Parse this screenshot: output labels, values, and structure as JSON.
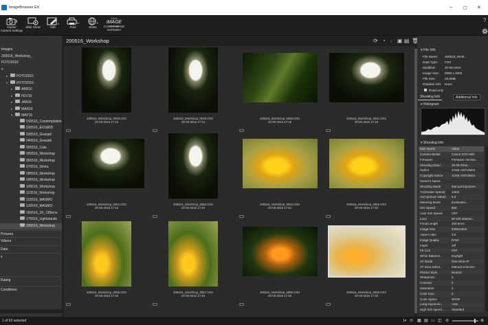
{
  "window": {
    "title": "ImageBrowser EX",
    "min": "–",
    "max": "◻",
    "close": "✕"
  },
  "toolbar": {
    "buttons": [
      {
        "label1": "Import/",
        "label2": "Camera Settings",
        "icon": "camera-icon"
      },
      {
        "label1": "Slide Show",
        "label2": "",
        "icon": "slideshow-icon"
      },
      {
        "label1": "Edit",
        "label2": "",
        "icon": "edit-icon"
      },
      {
        "label1": "Print",
        "label2": "",
        "icon": "printer-icon"
      },
      {
        "label1": "Share",
        "label2": "",
        "icon": "globe-icon"
      },
      {
        "label1": "CANON IMAGE",
        "label2": "GATEWAY",
        "icon": "canon-image-gateway-icon"
      }
    ],
    "help": "?",
    "gateway_logo_top": "Canon",
    "gateway_logo_main": "iMAGE",
    "gateway_logo_sub": "GATEWAY"
  },
  "sidebar": {
    "items": [
      {
        "label": "Images",
        "indent": 0,
        "arrow": "",
        "folder": false,
        "selected": false
      },
      {
        "label": "200516_Workshop_",
        "indent": 0,
        "arrow": "",
        "folder": false,
        "selected": false
      },
      {
        "label": "FOTO2016",
        "indent": 0,
        "arrow": "",
        "folder": false,
        "selected": false
      },
      {
        "label": "s",
        "indent": 0,
        "arrow": "",
        "folder": false,
        "selected": false
      },
      {
        "label": "FOTO2015",
        "indent": 1,
        "arrow": "▸",
        "folder": true,
        "selected": false
      },
      {
        "label": "FOTO2016",
        "indent": 1,
        "arrow": "▾",
        "folder": true,
        "selected": false
      },
      {
        "label": "ABR16",
        "indent": 2,
        "arrow": "▸",
        "folder": true,
        "selected": false
      },
      {
        "label": "FEV16",
        "indent": 2,
        "arrow": "▸",
        "folder": true,
        "selected": false
      },
      {
        "label": "JAN16",
        "indent": 2,
        "arrow": "▸",
        "folder": true,
        "selected": false
      },
      {
        "label": "MAR16",
        "indent": 2,
        "arrow": "▸",
        "folder": true,
        "selected": false
      },
      {
        "label": "MAY16",
        "indent": 2,
        "arrow": "▾",
        "folder": true,
        "selected": false
      },
      {
        "label": "010516_Contemplation",
        "indent": 3,
        "arrow": "",
        "folder": true,
        "selected": false
      },
      {
        "label": "030516_EOS80D",
        "indent": 3,
        "arrow": "",
        "folder": true,
        "selected": false
      },
      {
        "label": "030516_Granjall",
        "indent": 3,
        "arrow": "",
        "folder": true,
        "selected": false
      },
      {
        "label": "040516_Granjall",
        "indent": 3,
        "arrow": "",
        "folder": true,
        "selected": false
      },
      {
        "label": "050516_Cats",
        "indent": 3,
        "arrow": "",
        "folder": true,
        "selected": false
      },
      {
        "label": "050516_Workshop",
        "indent": 3,
        "arrow": "",
        "folder": true,
        "selected": false
      },
      {
        "label": "060516_Workshop",
        "indent": 3,
        "arrow": "",
        "folder": true,
        "selected": false
      },
      {
        "label": "070516_Sintra",
        "indent": 3,
        "arrow": "",
        "folder": true,
        "selected": false
      },
      {
        "label": "080516_Workshop",
        "indent": 3,
        "arrow": "",
        "folder": true,
        "selected": false
      },
      {
        "label": "090516_Workshop",
        "indent": 3,
        "arrow": "",
        "folder": true,
        "selected": false
      },
      {
        "label": "100516_Workshop",
        "indent": 3,
        "arrow": "",
        "folder": true,
        "selected": false
      },
      {
        "label": "110516_Workshop",
        "indent": 3,
        "arrow": "",
        "folder": true,
        "selected": false
      },
      {
        "label": "120516_MASMO",
        "indent": 3,
        "arrow": "",
        "folder": true,
        "selected": false
      },
      {
        "label": "130516_MASMO",
        "indent": 3,
        "arrow": "",
        "folder": true,
        "selected": false
      },
      {
        "label": "160516_18_135lens",
        "indent": 3,
        "arrow": "",
        "folder": true,
        "selected": false
      },
      {
        "label": "170516_Lightstands",
        "indent": 3,
        "arrow": "",
        "folder": true,
        "selected": false
      },
      {
        "label": "200516_Workshop",
        "indent": 3,
        "arrow": "",
        "folder": true,
        "selected": true
      }
    ],
    "sections": [
      "Pictures",
      "Videos",
      "",
      "Date",
      "s",
      "",
      "Rating",
      "",
      "Conditions"
    ]
  },
  "main": {
    "folder_title": "200516_Workshop",
    "search_placeholder": "",
    "thumbnails": [
      {
        "name": "200516_Workshop_0048.CR2",
        "date": "20-05-2016 17:15",
        "kind": "calla-dark",
        "orient": "portrait"
      },
      {
        "name": "200516_Workshop_0049.CR2",
        "date": "20-05-2016 17:16",
        "kind": "calla-dark",
        "orient": "portrait"
      },
      {
        "name": "200516_Workshop_0050.CR2",
        "date": "20-05-2016 17:18",
        "kind": "leaf",
        "orient": "landscape"
      },
      {
        "name": "200516_Workshop_0051.CR2",
        "date": "20-05-2016 17:18",
        "kind": "calla-dark",
        "orient": "landscape"
      },
      {
        "name": "200516_Workshop_0052.CR2",
        "date": "20-05-2016 17:19",
        "kind": "calla-dark",
        "orient": "landscape"
      },
      {
        "name": "200516_Workshop_0053.CR2",
        "date": "20-05-2016 17:20",
        "kind": "calla-dark",
        "orient": "portrait"
      },
      {
        "name": "200516_Workshop_0054.CR2",
        "date": "20-05-2016 17:34",
        "kind": "yellow",
        "orient": "landscape"
      },
      {
        "name": "200516_Workshop_0055.CR2",
        "date": "20-05-2016 17:35",
        "kind": "yellow",
        "orient": "landscape"
      },
      {
        "name": "200516_Workshop_0056.CR2",
        "date": "20-05-2016 17:36",
        "kind": "yellow-green",
        "orient": "portrait"
      },
      {
        "name": "200516_Workshop_0057.CR2",
        "date": "20-05-2016 17:36",
        "kind": "yellow-green",
        "orient": "portrait"
      },
      {
        "name": "200516_Workshop_0058.CR2",
        "date": "20-05-2016 17:38",
        "kind": "orange-dark",
        "orient": "landscape"
      },
      {
        "name": "200516_Workshop_0059.CR2",
        "date": "20-05-2016 17:39",
        "kind": "orange-light",
        "orient": "landscape",
        "selected": true
      }
    ]
  },
  "right_panel": {
    "file_info_title": "File Info",
    "file_info": [
      {
        "k": "File Name:",
        "v": "200516_Work..."
      },
      {
        "k": "Data Type:",
        "v": "CR2"
      },
      {
        "k": "Modified:",
        "v": "20-05-2016"
      },
      {
        "k": "Image Size:",
        "v": "6000 x 4000"
      },
      {
        "k": "File Size:",
        "v": "29,8MB"
      },
      {
        "k": "Rotation Info:",
        "v": "None"
      }
    ],
    "readonly": "Read-only",
    "tab1": "Shooting Info",
    "tab2": "Additional Info",
    "histogram_title": "Histogram",
    "shooting_title": "Shooting Info",
    "col_item": "Item Name",
    "col_value": "Value",
    "rows": [
      {
        "k": "Camera Model",
        "v": "Canon EOS 80D"
      },
      {
        "k": "Firmware",
        "v": "Firmware Version..."
      },
      {
        "k": "Shooting Date/...",
        "v": "20-05-2016..."
      },
      {
        "k": "Author",
        "v": "JOSE ANTUNES"
      },
      {
        "k": "Copyright Notice",
        "v": "JOSE ANTUNES"
      },
      {
        "k": "Owner's Name",
        "v": ""
      },
      {
        "k": "Shooting Mode",
        "v": "Manual Exposure"
      },
      {
        "k": "Tv(Shutter Speed)",
        "v": "1/500"
      },
      {
        "k": "Av(Aperture Value)",
        "v": "6.3"
      },
      {
        "k": "Metering Mode",
        "v": "Evaluative..."
      },
      {
        "k": "ISO Speed",
        "v": "800"
      },
      {
        "k": "  Auto ISO Speed",
        "v": "OFF"
      },
      {
        "k": "Lens",
        "v": "EF100-400mm..."
      },
      {
        "k": "Focal Length",
        "v": "400.0mm"
      },
      {
        "k": "Image Size",
        "v": "6000x4000"
      },
      {
        "k": "Aspect ratio",
        "v": "3:2"
      },
      {
        "k": "Image Quality",
        "v": "RAW"
      },
      {
        "k": "Flash",
        "v": "Off"
      },
      {
        "k": "FE lock",
        "v": "OFF"
      },
      {
        "k": "White Balance...",
        "v": "Daylight"
      },
      {
        "k": "AF Mode",
        "v": "One-Shot AF"
      },
      {
        "k": "AF area select...",
        "v": "Manual selection"
      },
      {
        "k": "Picture Style",
        "v": "Neutral"
      },
      {
        "k": "  Sharpness",
        "v": "0"
      },
      {
        "k": "  Contrast",
        "v": "0"
      },
      {
        "k": "  Saturation",
        "v": "0"
      },
      {
        "k": "  Color tone",
        "v": "0"
      },
      {
        "k": "Color Space",
        "v": "sRGB"
      },
      {
        "k": "Long exposure...",
        "v": "Auto"
      },
      {
        "k": "High ISO speed ...",
        "v": "Standard"
      }
    ]
  },
  "status": {
    "selection": "1 of 63 selected"
  }
}
